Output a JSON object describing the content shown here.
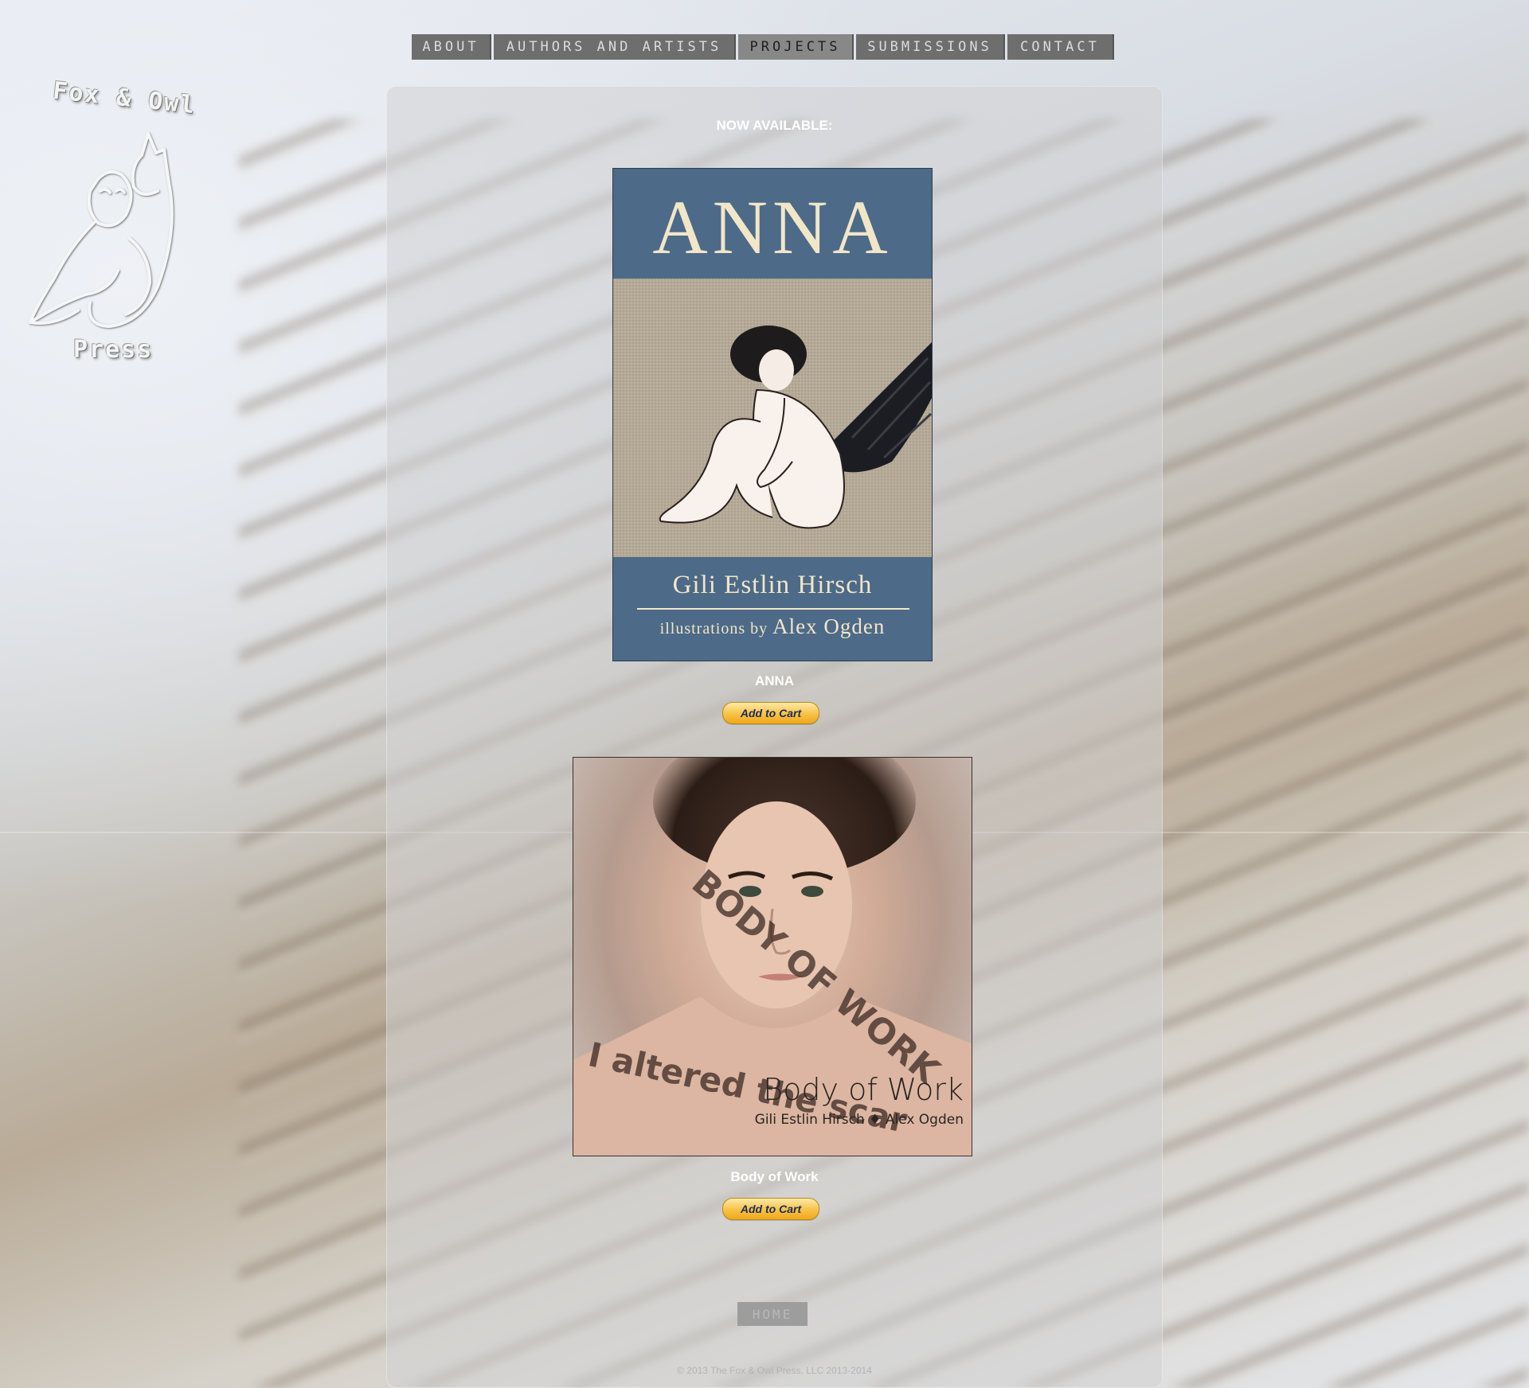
{
  "nav": {
    "items": [
      {
        "label": "ABOUT",
        "key": "about",
        "active": false
      },
      {
        "label": "AUTHORS AND ARTISTS",
        "key": "authors",
        "active": false
      },
      {
        "label": "PROJECTS",
        "key": "projects",
        "active": true
      },
      {
        "label": "SUBMISSIONS",
        "key": "submissions",
        "active": false
      },
      {
        "label": "CONTACT",
        "key": "contact",
        "active": false
      }
    ]
  },
  "logo": {
    "top_text": "Fox & Owl",
    "bottom_text": "Press"
  },
  "main": {
    "heading": "NOW AVAILABLE:",
    "books": [
      {
        "title": "ANNA",
        "cart_label": "Add to Cart",
        "cover": {
          "title": "ANNA",
          "author": "Gili Estlin Hirsch",
          "illustrator_prefix": "illustrations by",
          "illustrator": "Alex Ogden"
        }
      },
      {
        "title": "Body of Work",
        "cart_label": "Add to Cart",
        "cover": {
          "title": "Body of Work",
          "byline": "Gili Estlin Hirsch  ♦  Alex Ogden",
          "skin_text_1": "BODY OF WORK",
          "skin_text_2": "I altered the scar"
        }
      }
    ],
    "home_label": "HOME",
    "copyright": "© 2013 The Fox & Owl Press, LLC 2013-2014"
  },
  "colors": {
    "nav_bg": "#6e6e6e",
    "anna_cover_blue": "#4d6a88",
    "cover_cream": "#f1e6c8",
    "paypal_gold": "#f7c245"
  }
}
